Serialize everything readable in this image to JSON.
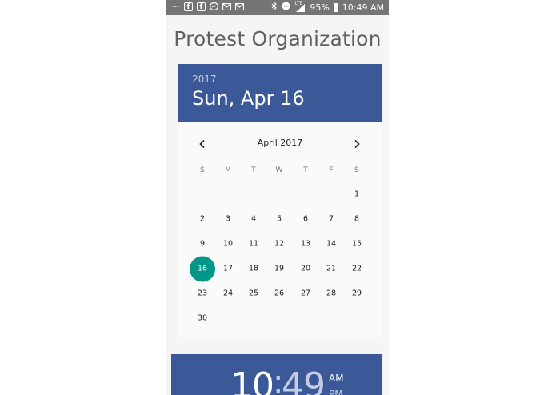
{
  "status_bar": {
    "battery": "95%",
    "time": "10:49 AM",
    "network": "LTE",
    "left_icons": [
      "chat-icon",
      "facebook-icon",
      "facebook-icon",
      "messenger-icon",
      "gmail-icon",
      "gmail-icon"
    ]
  },
  "app": {
    "title": "Protest Organization"
  },
  "date_header": {
    "year": "2017",
    "date": "Sun, Apr 16"
  },
  "calendar": {
    "month_label": "April 2017",
    "weekdays": [
      "S",
      "M",
      "T",
      "W",
      "T",
      "F",
      "S"
    ],
    "first_weekday_index": 6,
    "days_in_month": 30,
    "selected_day": 16,
    "selected_color": "#009688"
  },
  "time_header": {
    "hour": "10",
    "separator": ":",
    "minute": "49",
    "am": "AM",
    "pm": "PM"
  },
  "colors": {
    "header_bg": "#3b5998",
    "accent": "#009688",
    "status_bar": "#757575"
  }
}
